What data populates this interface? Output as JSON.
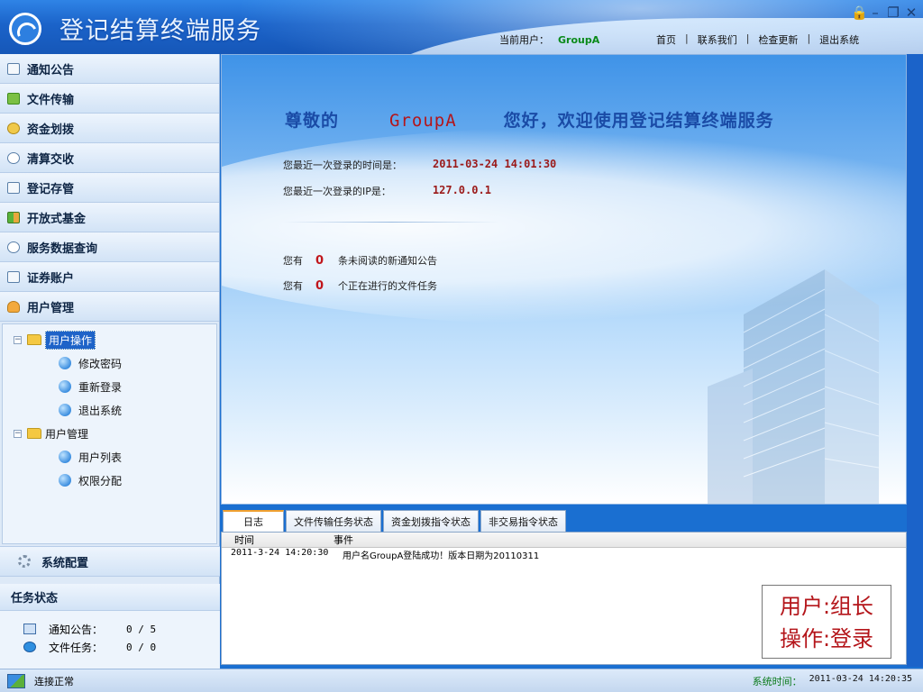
{
  "window": {
    "title": "登记结算终端服务",
    "controls": [
      "lock-icon",
      "minimize-icon",
      "restore-icon",
      "close-icon"
    ]
  },
  "user_bar": {
    "label": "当前用户：",
    "username": "GroupA"
  },
  "nav": {
    "home": "首页",
    "contact": "联系我们",
    "update": "检查更新",
    "logout": "退出系统",
    "separator": "|"
  },
  "sidebar": {
    "items": [
      {
        "label": "通知公告",
        "icon": "notice-icon"
      },
      {
        "label": "文件传输",
        "icon": "file-transfer-icon"
      },
      {
        "label": "资金划拨",
        "icon": "fund-transfer-icon"
      },
      {
        "label": "清算交收",
        "icon": "clearing-icon"
      },
      {
        "label": "登记存管",
        "icon": "registry-icon"
      },
      {
        "label": "开放式基金",
        "icon": "fund-icon"
      },
      {
        "label": "服务数据查询",
        "icon": "data-query-icon"
      },
      {
        "label": "证券账户",
        "icon": "account-icon"
      },
      {
        "label": "用户管理",
        "icon": "user-management-icon"
      }
    ],
    "tree": {
      "group1": "用户操作",
      "group1_children": [
        "修改密码",
        "重新登录",
        "退出系统"
      ],
      "group2": "用户管理",
      "group2_children": [
        "用户列表",
        "权限分配"
      ]
    },
    "system_config": "系统配置",
    "task_status": {
      "title": "任务状态",
      "notice_label": "通知公告：",
      "notice_value": "0 / 5",
      "file_label": "文件任务：",
      "file_value": "0 / 0"
    }
  },
  "main": {
    "greeting_prefix": "尊敬的",
    "greeting_user": "GroupA",
    "greeting_suffix": "您好，欢迎使用登记结算终端服务",
    "last_login_time_label": "您最近一次登录的时间是：",
    "last_login_time": "2011-03-24 14:01:30",
    "last_login_ip_label": "您最近一次登录的IP是：",
    "last_login_ip": "127.0.0.1",
    "unread_prefix": "您有",
    "unread_count": "0",
    "unread_suffix": "条未阅读的新通知公告",
    "task_prefix": "您有",
    "task_count": "0",
    "task_suffix": "个正在进行的文件任务"
  },
  "tabs": [
    "日志",
    "文件传输任务状态",
    "资金划拨指令状态",
    "非交易指令状态"
  ],
  "log": {
    "columns": [
      "时间",
      "事件"
    ],
    "rows": [
      {
        "time": "2011-3-24 14:20:30",
        "event": "用户名GroupA登陆成功！版本日期为20110311"
      }
    ]
  },
  "role_box": {
    "user_line": "用户:组长",
    "op_line": "操作:登录"
  },
  "status": {
    "connection": "连接正常",
    "time_label": "系统时间：",
    "time_value": "2011-03-24 14:20:35"
  },
  "colors": {
    "header": "#1b63c9",
    "accent_red": "#b4151a",
    "greeting_blue": "#1a4ba6",
    "user_green": "#0a8a1a"
  }
}
